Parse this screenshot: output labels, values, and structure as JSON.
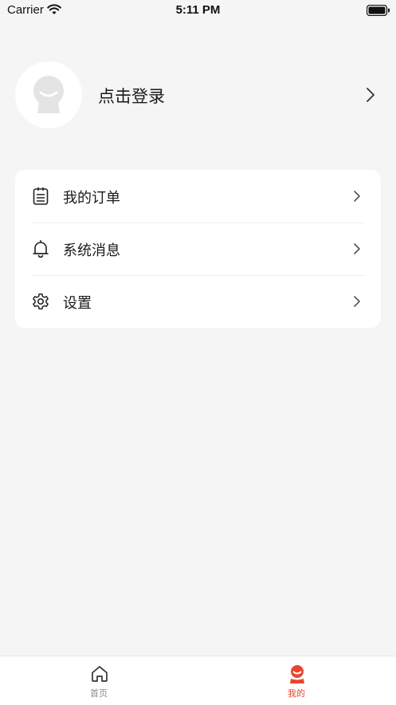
{
  "status_bar": {
    "carrier": "Carrier",
    "time": "5:11 PM"
  },
  "profile": {
    "login_label": "点击登录"
  },
  "menu": {
    "items": [
      {
        "label": "我的订单",
        "icon": "order-list-icon"
      },
      {
        "label": "系统消息",
        "icon": "bell-icon"
      },
      {
        "label": "设置",
        "icon": "gear-icon"
      }
    ]
  },
  "tabbar": {
    "tabs": [
      {
        "label": "首页",
        "icon": "home-icon",
        "active": false
      },
      {
        "label": "我的",
        "icon": "user-icon",
        "active": true
      }
    ]
  },
  "colors": {
    "accent": "#e8452f",
    "background": "#f5f5f5",
    "card": "#ffffff",
    "inactive_tab": "#8a8a8a"
  }
}
